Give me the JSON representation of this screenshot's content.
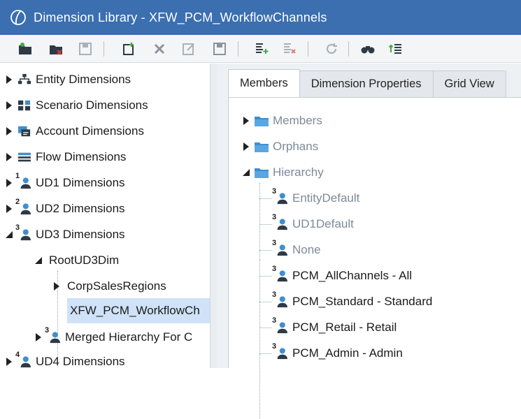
{
  "window": {
    "title": "Dimension Library - XFW_PCM_WorkflowChannels"
  },
  "colors": {
    "titlebar": "#3b6fb0",
    "selection": "#cfe2f7",
    "folder": "#3d8fd1",
    "user": "#2f6db3"
  },
  "toolbar": {
    "icons": [
      "folder-open-icon",
      "folder-delete-icon",
      "save-disabled-icon",
      "new-member-icon",
      "delete-x-icon",
      "edit-disabled-icon",
      "save-disabled-icon",
      "add-relationship-icon",
      "remove-relationship-icon",
      "refresh-icon",
      "search-binoculars-icon",
      "sort-list-icon"
    ]
  },
  "left_tree": [
    {
      "label": "Entity Dimensions",
      "icon": "entity-icon",
      "state": "collapsed",
      "level": 0
    },
    {
      "label": "Scenario Dimensions",
      "icon": "scenario-icon",
      "state": "collapsed",
      "level": 0
    },
    {
      "label": "Account Dimensions",
      "icon": "account-icon",
      "state": "collapsed",
      "level": 0
    },
    {
      "label": "Flow Dimensions",
      "icon": "flow-icon",
      "state": "collapsed",
      "level": 0
    },
    {
      "label": "UD1 Dimensions",
      "badge": "1",
      "icon": "ud-icon",
      "state": "collapsed",
      "level": 0
    },
    {
      "label": "UD2 Dimensions",
      "badge": "2",
      "icon": "ud-icon",
      "state": "collapsed",
      "level": 0
    },
    {
      "label": "UD3 Dimensions",
      "badge": "3",
      "icon": "ud-icon",
      "state": "expanded",
      "level": 0
    },
    {
      "label": "RootUD3Dim",
      "state": "expanded",
      "level": 1
    },
    {
      "label": "CorpSalesRegions",
      "state": "collapsed",
      "level": 2
    },
    {
      "label": "XFW_PCM_WorkflowCh",
      "state": "leaf",
      "level": 2,
      "selected": true
    },
    {
      "label": "Merged Hierarchy For C",
      "badge": "3",
      "icon": "ud-icon",
      "state": "collapsed",
      "level": 1
    },
    {
      "label": "UD4 Dimensions",
      "badge": "4",
      "icon": "ud-icon",
      "state": "collapsed",
      "level": 0
    }
  ],
  "tabs": [
    {
      "label": "Members",
      "active": true
    },
    {
      "label": "Dimension Properties",
      "active": false
    },
    {
      "label": "Grid View",
      "active": false
    }
  ],
  "member_tree": [
    {
      "label": "Members",
      "type": "folder",
      "state": "collapsed",
      "muted": true
    },
    {
      "label": "Orphans",
      "type": "folder",
      "state": "collapsed",
      "muted": true
    },
    {
      "label": "Hierarchy",
      "type": "folder",
      "state": "expanded",
      "muted": true
    },
    {
      "label": "EntityDefault",
      "type": "member",
      "badge": "3",
      "muted": true
    },
    {
      "label": "UD1Default",
      "type": "member",
      "badge": "3",
      "muted": true
    },
    {
      "label": "None",
      "type": "member",
      "badge": "3",
      "muted": true
    },
    {
      "label": "PCM_AllChannels - All",
      "type": "member",
      "badge": "3",
      "muted": false
    },
    {
      "label": "PCM_Standard - Standard",
      "type": "member",
      "badge": "3",
      "muted": false
    },
    {
      "label": "PCM_Retail - Retail",
      "type": "member",
      "badge": "3",
      "muted": false
    },
    {
      "label": "PCM_Admin - Admin",
      "type": "member",
      "badge": "3",
      "muted": false
    }
  ]
}
